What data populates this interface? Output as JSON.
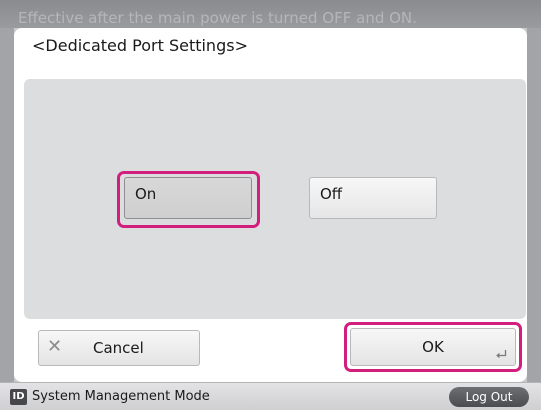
{
  "background": {
    "notice": "Effective after the main power is turned OFF and ON."
  },
  "dialog": {
    "title": "<Dedicated Port Settings>",
    "options": [
      {
        "label": "On",
        "selected": true
      },
      {
        "label": "Off",
        "selected": false
      }
    ],
    "cancel_label": "Cancel",
    "ok_label": "OK"
  },
  "status_bar": {
    "id_badge": "ID",
    "mode_label": "System Management Mode",
    "logout_label": "Log Out"
  },
  "colors": {
    "highlight": "#d21f7d",
    "panel": "#dcdddf"
  },
  "icons": {
    "cancel": "close-icon",
    "ok": "enter-icon",
    "id": "id-icon"
  }
}
